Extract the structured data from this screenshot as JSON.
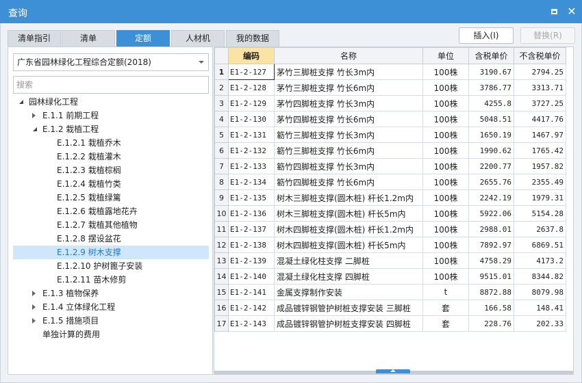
{
  "window": {
    "title": "查询",
    "maximize_icon": "maximize-icon",
    "close_icon": "close-icon"
  },
  "tabs": [
    {
      "label": "清单指引",
      "active": false
    },
    {
      "label": "清单",
      "active": false
    },
    {
      "label": "定额",
      "active": true
    },
    {
      "label": "人材机",
      "active": false
    },
    {
      "label": "我的数据",
      "active": false
    }
  ],
  "buttons": {
    "insert": "插入(I)",
    "replace": "替换(R)"
  },
  "left": {
    "library_select": "广东省园林绿化工程综合定额(2018)",
    "search_placeholder": "搜索",
    "tree": [
      {
        "label": "园林绿化工程",
        "expanded": true
      },
      {
        "label": "E.1.1 前期工程",
        "expanded": false
      },
      {
        "label": "E.1.2 栽植工程",
        "expanded": true
      },
      {
        "label": "E.1.2.1 栽植乔木"
      },
      {
        "label": "E.1.2.2 栽植灌木"
      },
      {
        "label": "E.1.2.3 栽植棕榈"
      },
      {
        "label": "E.1.2.4 栽植竹类"
      },
      {
        "label": "E.1.2.5 栽植绿篱"
      },
      {
        "label": "E.1.2.6 栽植露地花卉"
      },
      {
        "label": "E.1.2.7 栽植其他植物"
      },
      {
        "label": "E.1.2.8 摆设盆花"
      },
      {
        "label": "E.1.2.9 树木支撑",
        "selected": true
      },
      {
        "label": "E.1.2.10 护树篦子安装"
      },
      {
        "label": "E.1.2.11 苗木修剪"
      },
      {
        "label": "E.1.3 植物保养",
        "expanded": false
      },
      {
        "label": "E.1.4 立体绿化工程",
        "expanded": false
      },
      {
        "label": "E.1.5 措施项目",
        "expanded": false
      },
      {
        "label": "单独计算的费用"
      }
    ]
  },
  "grid": {
    "headers": [
      "编码",
      "名称",
      "单位",
      "含税单价",
      "不含税单价"
    ],
    "rows": [
      {
        "no": "1",
        "code": "E1-2-127",
        "name": "茅竹三脚桩支撑 竹长3m内",
        "unit": "100株",
        "price_tax": "3190.67",
        "price_notax": "2794.25"
      },
      {
        "no": "2",
        "code": "E1-2-128",
        "name": "茅竹三脚桩支撑 竹长6m内",
        "unit": "100株",
        "price_tax": "3786.77",
        "price_notax": "3313.71"
      },
      {
        "no": "3",
        "code": "E1-2-129",
        "name": "茅竹四脚桩支撑 竹长3m内",
        "unit": "100株",
        "price_tax": "4255.8",
        "price_notax": "3727.25"
      },
      {
        "no": "4",
        "code": "E1-2-130",
        "name": "茅竹四脚桩支撑 竹长6m内",
        "unit": "100株",
        "price_tax": "5048.51",
        "price_notax": "4417.76"
      },
      {
        "no": "5",
        "code": "E1-2-131",
        "name": "簕竹三脚桩支撑 竹长3m内",
        "unit": "100株",
        "price_tax": "1650.19",
        "price_notax": "1467.97"
      },
      {
        "no": "6",
        "code": "E1-2-132",
        "name": "簕竹三脚桩支撑 竹长6m内",
        "unit": "100株",
        "price_tax": "1990.62",
        "price_notax": "1765.42"
      },
      {
        "no": "7",
        "code": "E1-2-133",
        "name": "簕竹四脚桩支撑 竹长3m内",
        "unit": "100株",
        "price_tax": "2200.77",
        "price_notax": "1957.82"
      },
      {
        "no": "8",
        "code": "E1-2-134",
        "name": "簕竹四脚桩支撑 竹长6m内",
        "unit": "100株",
        "price_tax": "2655.76",
        "price_notax": "2355.49"
      },
      {
        "no": "9",
        "code": "E1-2-135",
        "name": "树木三脚桩支撑(圆木桩) 杆长1.2m内",
        "unit": "100株",
        "price_tax": "2242.19",
        "price_notax": "1979.31"
      },
      {
        "no": "10",
        "code": "E1-2-136",
        "name": "树木三脚桩支撑(圆木桩) 杆长5m内",
        "unit": "100株",
        "price_tax": "5922.06",
        "price_notax": "5154.28"
      },
      {
        "no": "11",
        "code": "E1-2-137",
        "name": "树木四脚桩支撑(圆木桩) 杆长1.2m内",
        "unit": "100株",
        "price_tax": "2988.01",
        "price_notax": "2637.8"
      },
      {
        "no": "12",
        "code": "E1-2-138",
        "name": "树木四脚桩支撑(圆木桩) 杆长5m内",
        "unit": "100株",
        "price_tax": "7892.97",
        "price_notax": "6869.51"
      },
      {
        "no": "13",
        "code": "E1-2-139",
        "name": "混凝土绿化柱支撑 二脚桩",
        "unit": "100株",
        "price_tax": "4758.29",
        "price_notax": "4173.2"
      },
      {
        "no": "14",
        "code": "E1-2-140",
        "name": "混凝土绿化柱支撑 四脚桩",
        "unit": "100株",
        "price_tax": "9515.01",
        "price_notax": "8344.82"
      },
      {
        "no": "15",
        "code": "E1-2-141",
        "name": "金属支撑制作安装",
        "unit": "t",
        "price_tax": "8872.88",
        "price_notax": "8079.98"
      },
      {
        "no": "16",
        "code": "E1-2-142",
        "name": "成品镀锌钢管护树桩支撑安装 三脚桩",
        "unit": "套",
        "price_tax": "166.58",
        "price_notax": "148.41"
      },
      {
        "no": "17",
        "code": "E1-2-143",
        "name": "成品镀锌钢管护树桩支撑安装 四脚桩",
        "unit": "套",
        "price_tax": "228.76",
        "price_notax": "202.33"
      }
    ]
  },
  "colors": {
    "accent": "#3d8fd6",
    "selected_tree_bg": "#cfe6fb",
    "selected_column_header": "#fbe3a4"
  }
}
